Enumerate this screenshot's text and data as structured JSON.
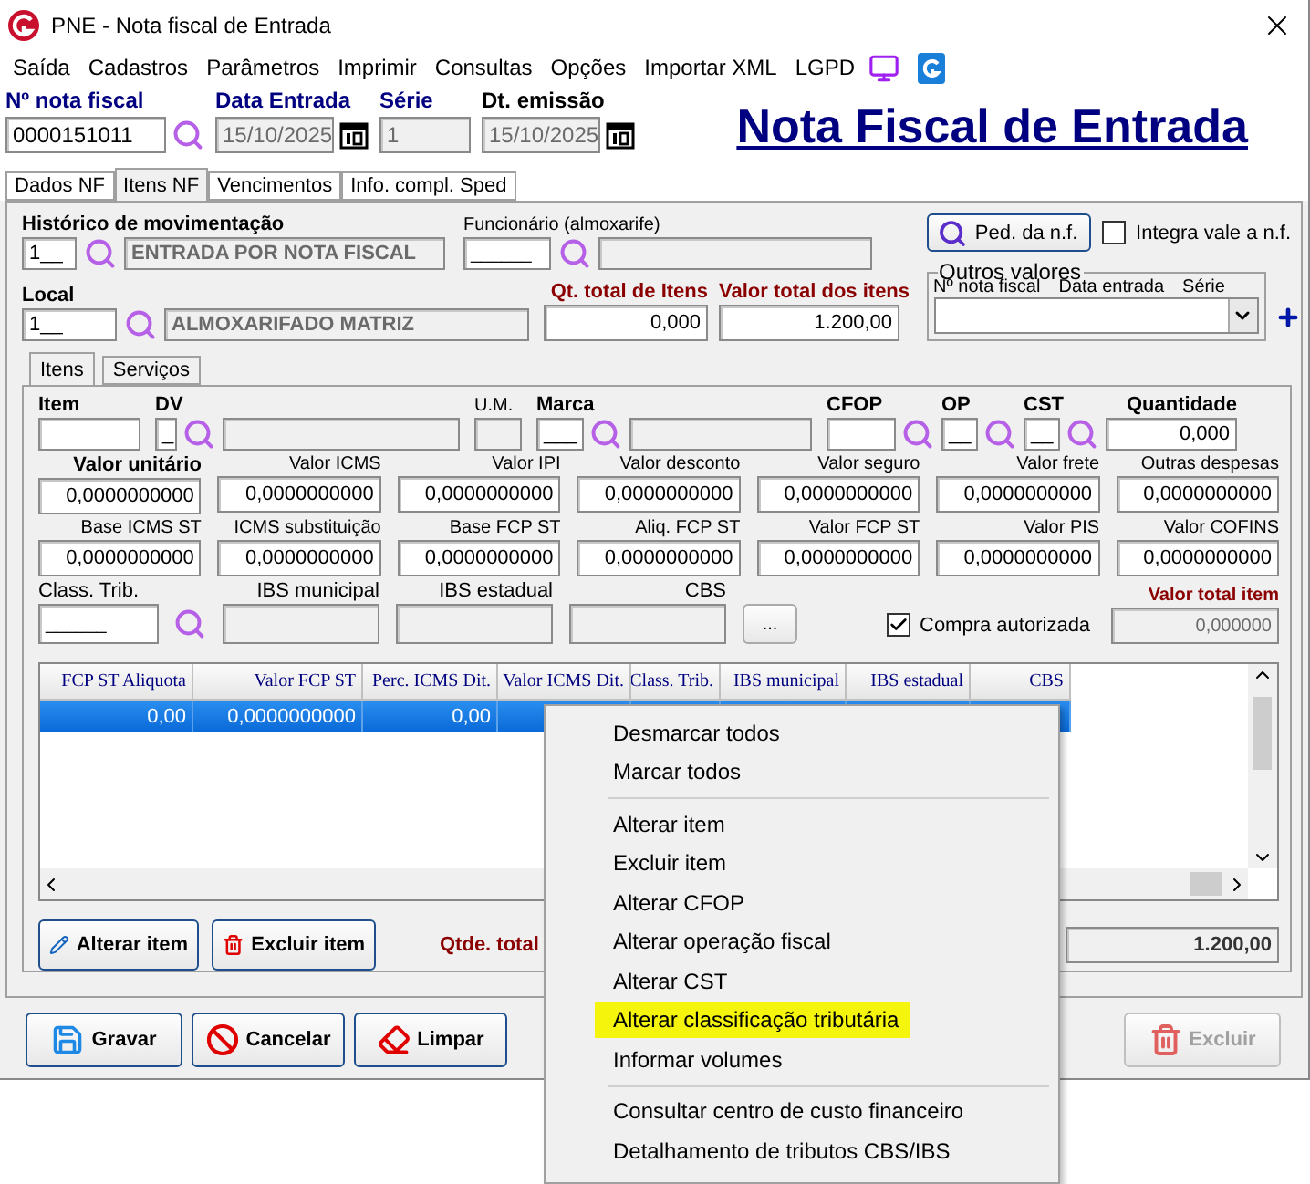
{
  "window": {
    "title": "PNE - Nota fiscal de Entrada"
  },
  "menu": [
    "Saída",
    "Cadastros",
    "Parâmetros",
    "Imprimir",
    "Consultas",
    "Opções",
    "Importar XML",
    "LGPD"
  ],
  "header": {
    "fields": [
      {
        "label": "Nº nota fiscal",
        "value": "0000151011",
        "color": "#000080",
        "kind": "lookup"
      },
      {
        "label": "Data Entrada",
        "value": "15/10/2025",
        "color": "#000080",
        "kind": "date"
      },
      {
        "label": "Série",
        "value": "1",
        "color": "#000080",
        "kind": "text"
      },
      {
        "label": "Dt. emissão",
        "value": "15/10/2025",
        "color": "#000000",
        "kind": "date"
      }
    ],
    "title": "Nota Fiscal de Entrada"
  },
  "tabs": [
    {
      "label": "Dados NF",
      "selected": false
    },
    {
      "label": "Itens NF",
      "selected": true
    },
    {
      "label": "Vencimentos",
      "selected": false
    },
    {
      "label": "Info. compl. Sped",
      "selected": false
    }
  ],
  "movement": {
    "label": "Histórico de movimentação",
    "code": "1__",
    "description": "ENTRADA POR NOTA FISCAL"
  },
  "employee": {
    "label": "Funcionário (almoxarife)",
    "code": "______"
  },
  "order_button": "Ped. da n.f.",
  "integrate": {
    "label": "Integra vale a n.f.",
    "checked": false
  },
  "location": {
    "label": "Local",
    "code": "1__",
    "description": "ALMOXARIFADO MATRIZ"
  },
  "total_qty": {
    "label": "Qt. total de Itens",
    "value": "0,000"
  },
  "total_value": {
    "label": "Valor total dos itens",
    "value": "1.200,00"
  },
  "other_values": {
    "title": "Outros valores",
    "columns": [
      "Nº nota fiscal",
      "Data entrada",
      "Série"
    ]
  },
  "inner_tabs": [
    {
      "label": "Itens",
      "selected": true
    },
    {
      "label": "Serviços",
      "selected": false
    }
  ],
  "item_row": [
    {
      "label": "Item",
      "bold": true,
      "kind": "field"
    },
    {
      "label": "DV",
      "bold": true,
      "value": "_",
      "kind": "lookup"
    },
    {
      "kind": "readonly"
    },
    {
      "label": "U.M.",
      "bold": false,
      "kind": "readonly"
    },
    {
      "label": "Marca",
      "bold": true,
      "value": "___",
      "kind": "lookup"
    },
    {
      "kind": "readonly"
    },
    {
      "label": "CFOP",
      "bold": true,
      "kind": "lookup"
    },
    {
      "label": "OP",
      "bold": true,
      "value": "__",
      "kind": "lookup"
    },
    {
      "label": "CST",
      "bold": true,
      "value": "__",
      "kind": "lookup"
    },
    {
      "label": "Quantidade",
      "bold": true,
      "value": "0,000",
      "kind": "field"
    }
  ],
  "value_rows": [
    [
      {
        "label": "Valor unitário",
        "bold": true,
        "value": "0,0000000000"
      },
      {
        "label": "Valor ICMS",
        "bold": false,
        "value": "0,0000000000"
      },
      {
        "label": "Valor IPI",
        "bold": false,
        "value": "0,0000000000"
      },
      {
        "label": "Valor desconto",
        "bold": false,
        "value": "0,0000000000"
      },
      {
        "label": "Valor seguro",
        "bold": false,
        "value": "0,0000000000"
      },
      {
        "label": "Valor frete",
        "bold": false,
        "value": "0,0000000000"
      },
      {
        "label": "Outras despesas",
        "bold": false,
        "value": "0,0000000000"
      }
    ],
    [
      {
        "label": "Base ICMS ST",
        "bold": false,
        "value": "0,0000000000"
      },
      {
        "label": "ICMS substituição",
        "bold": false,
        "value": "0,0000000000"
      },
      {
        "label": "Base FCP ST",
        "bold": false,
        "value": "0,0000000000"
      },
      {
        "label": "Aliq. FCP ST",
        "bold": false,
        "value": "0,0000000000"
      },
      {
        "label": "Valor FCP ST",
        "bold": false,
        "value": "0,0000000000"
      },
      {
        "label": "Valor PIS",
        "bold": false,
        "value": "0,0000000000"
      },
      {
        "label": "Valor COFINS",
        "bold": false,
        "value": "0,0000000000"
      }
    ]
  ],
  "tax_row": [
    {
      "label": "Class. Trib.",
      "value": "______",
      "kind": "lookup"
    },
    {
      "label": "IBS municipal",
      "kind": "readonly"
    },
    {
      "label": "IBS estadual",
      "kind": "readonly"
    },
    {
      "label": "CBS",
      "kind": "readonly"
    }
  ],
  "more_button": "...",
  "authorized": {
    "label": "Compra autorizada",
    "checked": true
  },
  "total_item": {
    "label": "Valor total item",
    "value": "0,000000"
  },
  "grid": {
    "columns": [
      "FCP ST Aliquota",
      "Valor FCP ST",
      "Perc. ICMS Dit.",
      "Valor ICMS Dit.",
      "Class. Trib.",
      "IBS municipal",
      "IBS estadual",
      "CBS"
    ],
    "rows": [
      {
        "selected": true,
        "cells": [
          "0,00",
          "0,0000000000",
          "0,00"
        ]
      }
    ]
  },
  "item_buttons": [
    {
      "label": "Alterar item",
      "kind": "edit"
    },
    {
      "label": "Excluir item",
      "kind": "delete"
    }
  ],
  "qty_total_label": "Qtde. total",
  "total_sum": "1.200,00",
  "footer_buttons": [
    {
      "label": "Gravar",
      "kind": "save",
      "disabled": false
    },
    {
      "label": "Cancelar",
      "kind": "cancel",
      "disabled": false
    },
    {
      "label": "Limpar",
      "kind": "clear",
      "disabled": false
    },
    {
      "label": "Excluir",
      "kind": "delete",
      "disabled": true
    }
  ],
  "context_menu": [
    {
      "kind": "item",
      "label": "Desmarcar todos",
      "selected": false
    },
    {
      "kind": "item",
      "label": "Marcar todos",
      "selected": false
    },
    {
      "kind": "separator"
    },
    {
      "kind": "item",
      "label": "Alterar item",
      "selected": false
    },
    {
      "kind": "item",
      "label": "Excluir item",
      "selected": false
    },
    {
      "kind": "item",
      "label": "Alterar CFOP",
      "selected": false
    },
    {
      "kind": "item",
      "label": "Alterar operação fiscal",
      "selected": false
    },
    {
      "kind": "item",
      "label": "Alterar CST",
      "selected": false
    },
    {
      "kind": "item",
      "label": "Alterar classificação tributária",
      "selected": true
    },
    {
      "kind": "item",
      "label": "Informar volumes",
      "selected": false
    },
    {
      "kind": "separator"
    },
    {
      "kind": "item",
      "label": "Consultar centro de custo financeiro",
      "selected": false
    },
    {
      "kind": "item",
      "label": "Detalhamento de tributos CBS/IBS",
      "selected": false
    }
  ]
}
